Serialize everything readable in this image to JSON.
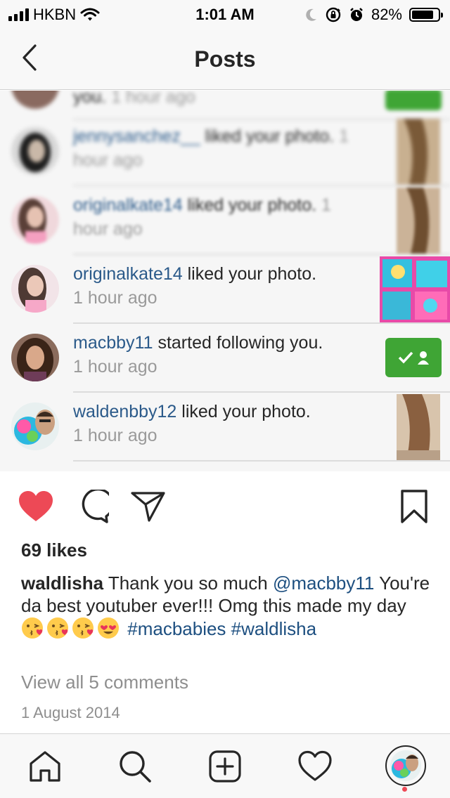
{
  "status_bar": {
    "carrier": "HKBN",
    "time": "1:01 AM",
    "battery": "82%",
    "battery_level": 0.82,
    "icons": [
      "signal-icon",
      "wifi-icon",
      "moon-icon",
      "rotation-lock-icon",
      "alarm-icon",
      "battery-icon"
    ]
  },
  "nav": {
    "title": "Posts",
    "back_icon": "chevron-left-icon"
  },
  "post_image": {
    "feed": [
      {
        "user": "",
        "action": "you.",
        "time": "1 hour ago",
        "blurred": true
      },
      {
        "user": "jennysanchez__",
        "action": "liked your photo.",
        "time": "1 hour ago",
        "blurred": true
      },
      {
        "user": "originalkate14",
        "action": "liked your photo.",
        "time": "1 hour ago",
        "blurred": true
      },
      {
        "user": "originalkate14",
        "action": "liked your photo.",
        "time": "1 hour ago",
        "blurred": false
      },
      {
        "user": "macbby11",
        "action": "started following you.",
        "time": "1 hour ago",
        "blurred": false
      },
      {
        "user": "waldenbby12",
        "action": "liked your photo.",
        "time": "1 hour ago",
        "blurred": false
      }
    ]
  },
  "actions": {
    "like_icon": "heart-filled-icon",
    "comment_icon": "comment-icon",
    "share_icon": "paper-plane-icon",
    "save_icon": "bookmark-icon",
    "like_color": "#ed4956"
  },
  "likes": "69 likes",
  "caption": {
    "username": "waldlisha",
    "text_1": "Thank you so much",
    "mention": "@macbby11",
    "text_2": "You're da best youtuber ever!!! Omg this made my day",
    "emojis": [
      "kissing-heart-emoji",
      "kissing-heart-emoji",
      "kissing-heart-emoji",
      "heart-eyes-emoji"
    ],
    "hashtag_1": "#macbabies",
    "hashtag_2": "#waldlisha"
  },
  "view_comments": "View all 5 comments",
  "date": "1 August 2014",
  "tab_bar": {
    "items": [
      "home-icon",
      "search-icon",
      "new-post-icon",
      "activity-heart-icon",
      "profile-avatar"
    ]
  }
}
